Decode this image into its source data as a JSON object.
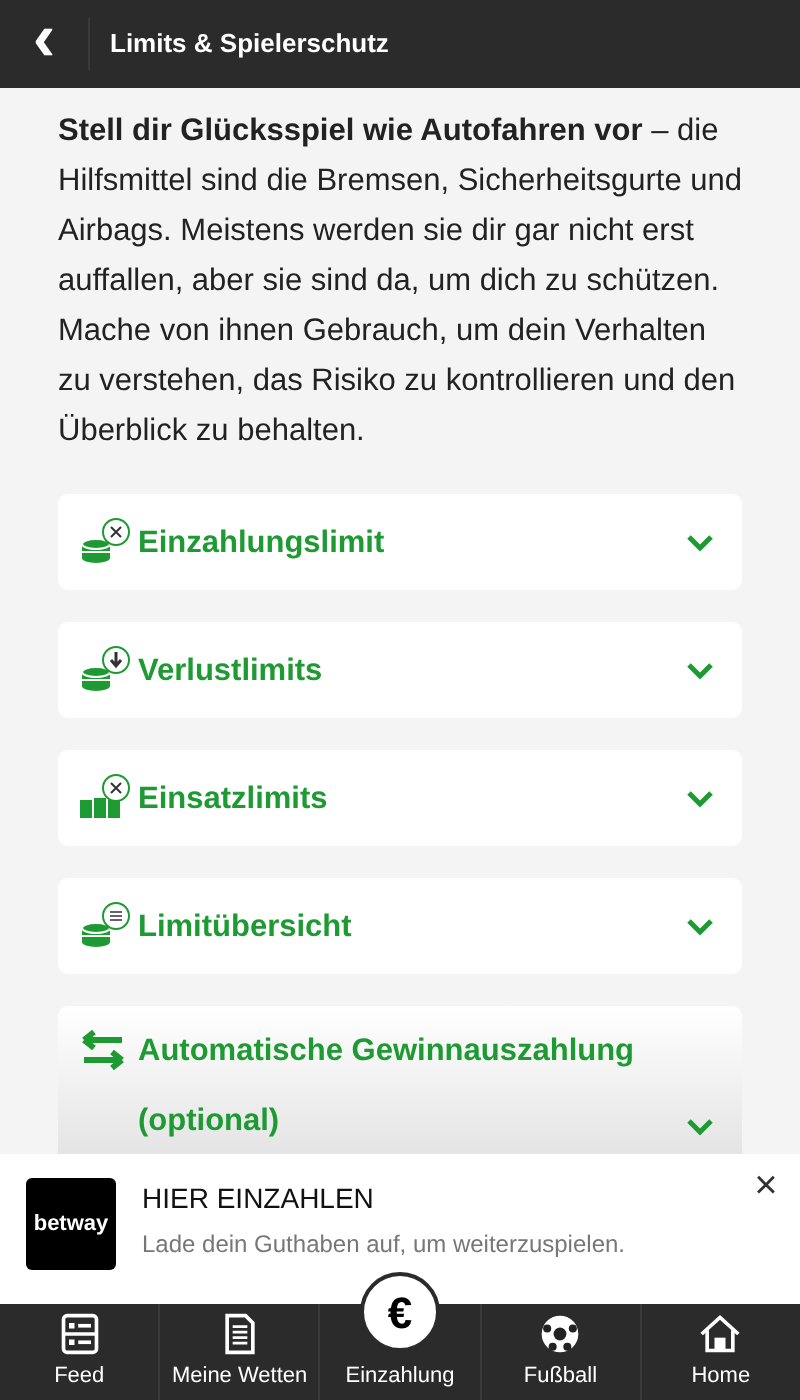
{
  "header": {
    "back": "‹",
    "title": "Limits & Spielerschutz"
  },
  "intro": "**Stell dir Glücksspiel wie Autofahren vor** – die Hilfsmittel sind die Bremsen, Sicherheitsgurte und Airbags. Meistens werden sie dir gar nicht erst auffallen, aber sie sind da, um dich zu schützen. Mache von ihnen Gebrauch, um dein Verhalten zu verstehen, das Risiko zu kontrollieren und den Überblick zu behalten.",
  "sections": [
    {
      "kind": "deposit",
      "label": "Einzahlungslimit",
      "expanded": false
    },
    {
      "kind": "loss",
      "label": "Verlustlimits",
      "expanded": false
    },
    {
      "kind": "stake",
      "label": "Einsatzlimits",
      "expanded": false
    },
    {
      "kind": "overview",
      "label": "Limitübersicht",
      "expanded": false
    },
    {
      "kind": "payout",
      "label": "Automatische Gewinnauszahlung (optional)",
      "expanded": false
    }
  ],
  "banner": {
    "logo": "betway",
    "title": "HIER EINZAHLEN",
    "text": "Lade dein Guthaben auf, um weiterzuspielen.",
    "close": "×"
  },
  "nav": [
    {
      "kind": "feed",
      "label": "Feed"
    },
    {
      "kind": "bets",
      "label": "Meine Wetten"
    },
    {
      "kind": "deposit",
      "label": "Einzahlung",
      "symbol": "€"
    },
    {
      "kind": "football",
      "label": "Fußball"
    },
    {
      "kind": "home",
      "label": "Home"
    }
  ]
}
